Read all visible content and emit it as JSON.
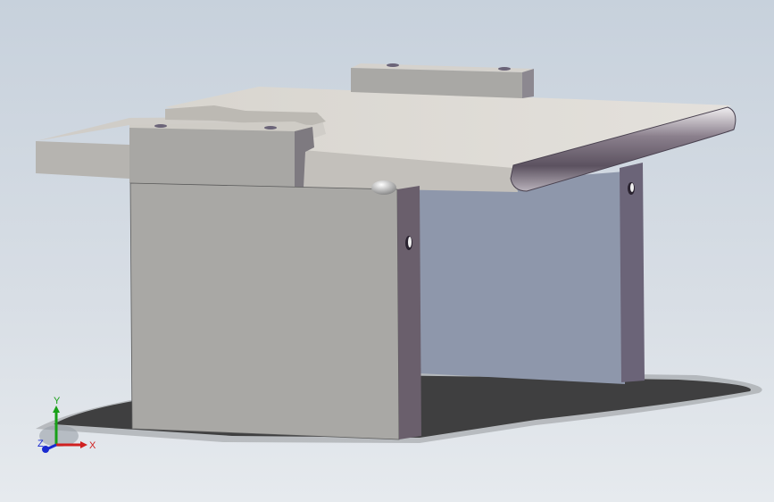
{
  "viewport": {
    "background_top": "#c7d1dc",
    "background_bottom": "#e6eaee"
  },
  "triad": {
    "x_label": "X",
    "y_label": "Y",
    "z_label": "Z",
    "x_color": "#d02020",
    "y_color": "#18a018",
    "z_color": "#1a2ad0"
  },
  "model": {
    "part_color_light": "#dcd9d4",
    "part_color_mid": "#a9a8a5",
    "part_color_dark": "#6e6670",
    "back_panel_color": "#8e97ab"
  }
}
